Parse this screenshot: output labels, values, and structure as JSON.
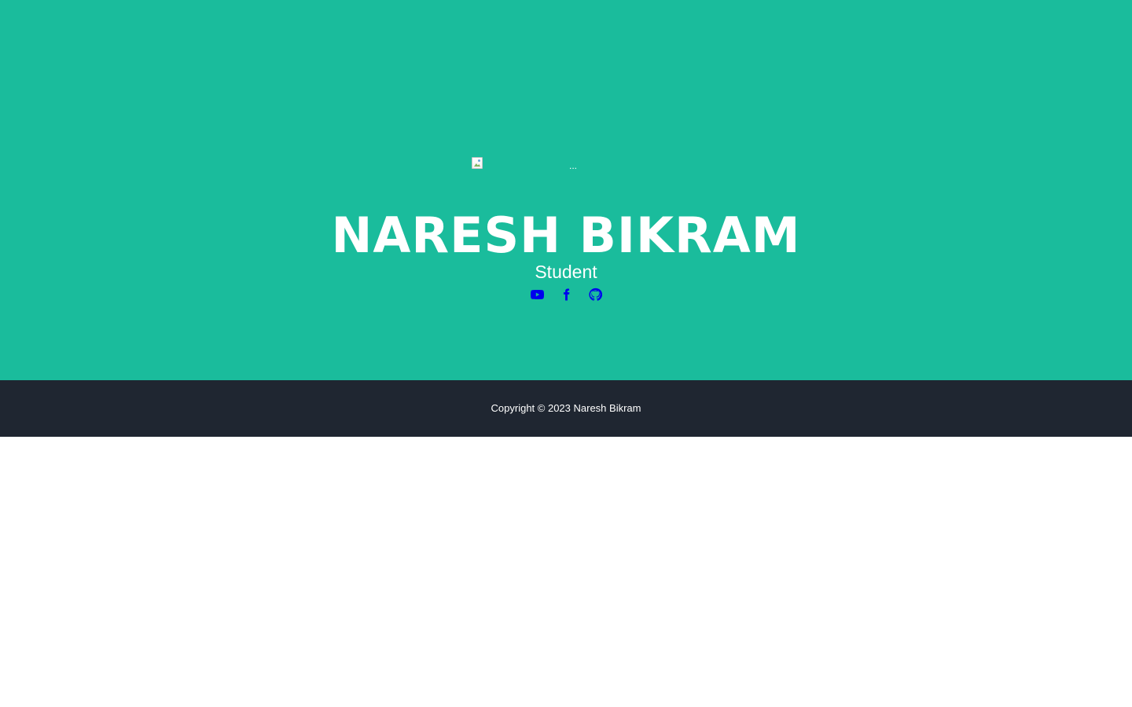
{
  "header": {
    "avatar_alt": "...",
    "name": "NARESH BIKRAM",
    "subtitle": "Student"
  },
  "social_links": [
    {
      "icon": "youtube-icon"
    },
    {
      "icon": "facebook-icon"
    },
    {
      "icon": "github-icon"
    }
  ],
  "footer": {
    "copyright": "Copyright © 2023 Naresh Bikram"
  },
  "colors": {
    "masthead_bg": "#1abc9c",
    "footer_bg": "#1f2631",
    "link": "#0000ee",
    "text": "#ffffff"
  }
}
